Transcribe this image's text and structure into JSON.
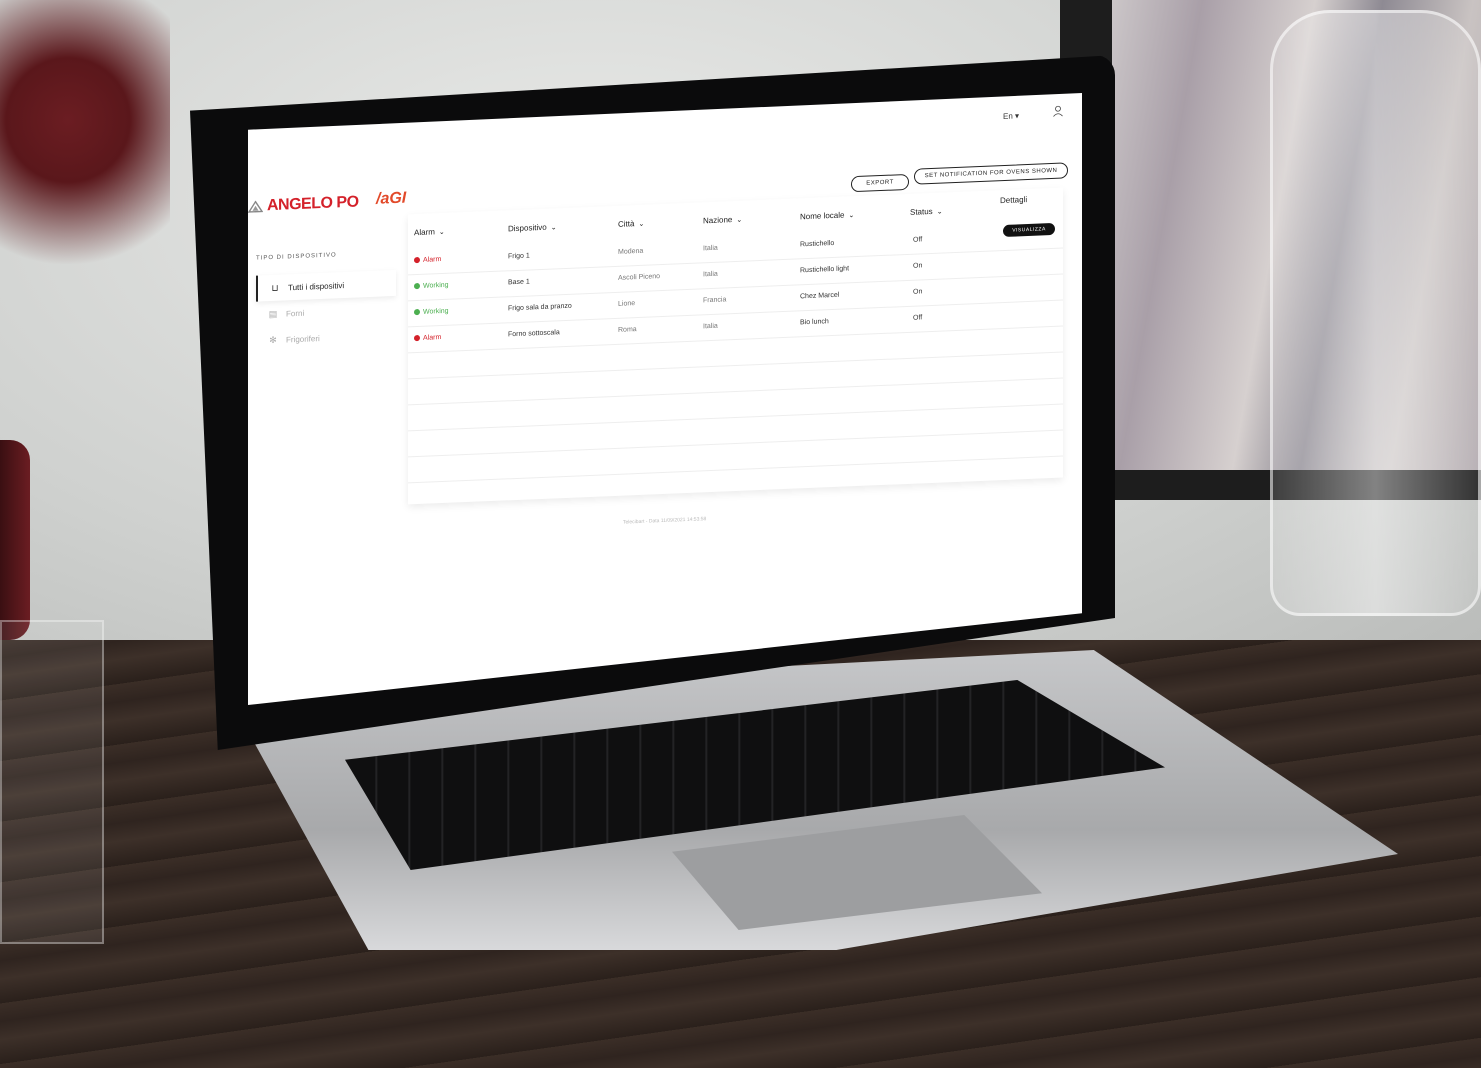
{
  "header": {
    "language": "En",
    "brand_primary": "ANGELO PO",
    "brand_secondary": "/aGI",
    "export_label": "EXPORT",
    "notification_label": "SET NOTIFICATION FOR OVENS SHOWN",
    "accent_color": "#d4212a"
  },
  "sidebar": {
    "title": "TIPO DI DISPOSITIVO",
    "items": [
      {
        "label": "Tutti i dispositivi",
        "icon": "all-devices-icon",
        "active": true
      },
      {
        "label": "Forni",
        "icon": "oven-icon",
        "active": false
      },
      {
        "label": "Frigoriferi",
        "icon": "snowflake-icon",
        "active": false
      }
    ]
  },
  "table": {
    "columns": [
      "Alarm",
      "Dispositivo",
      "Città",
      "Nazione",
      "Nome locale",
      "Status",
      "Dettagli"
    ],
    "details_button": "VISUALIZZA",
    "rows": [
      {
        "alarm": "Alarm",
        "alarm_type": "alarm",
        "device": "Frigo 1",
        "city": "Modena",
        "country": "Italia",
        "place": "Rustichello",
        "status": "Off"
      },
      {
        "alarm": "Working",
        "alarm_type": "working",
        "device": "Base 1",
        "city": "Ascoli Piceno",
        "country": "Italia",
        "place": "Rustichello light",
        "status": "On"
      },
      {
        "alarm": "Working",
        "alarm_type": "working",
        "device": "Frigo sala da pranzo",
        "city": "Lione",
        "country": "Francia",
        "place": "Chez Marcel",
        "status": "On"
      },
      {
        "alarm": "Alarm",
        "alarm_type": "alarm",
        "device": "Forno sottoscala",
        "city": "Roma",
        "country": "Italia",
        "place": "Bio lunch",
        "status": "Off"
      }
    ]
  },
  "footer": {
    "text": "Telecibart - Data 11/09/2021 14:53:58"
  }
}
